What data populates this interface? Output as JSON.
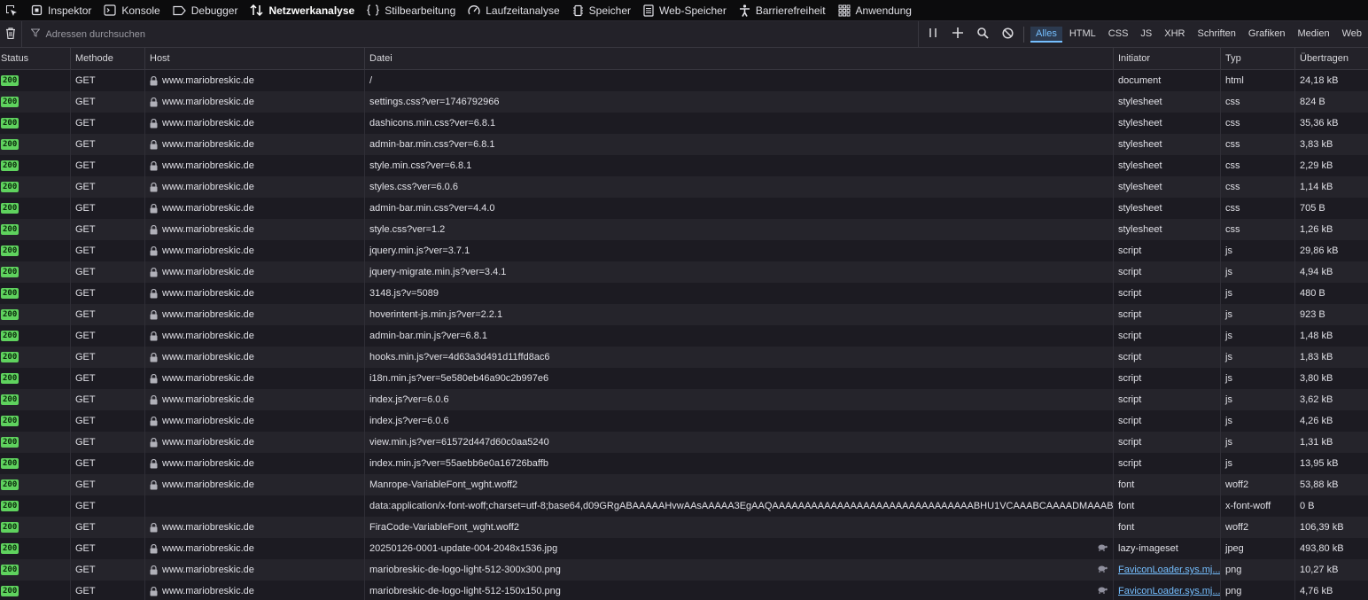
{
  "tabs": [
    {
      "label": "Inspektor",
      "icon": "inspector-icon"
    },
    {
      "label": "Konsole",
      "icon": "console-icon"
    },
    {
      "label": "Debugger",
      "icon": "debugger-icon"
    },
    {
      "label": "Netzwerkanalyse",
      "icon": "network-icon",
      "active": true
    },
    {
      "label": "Stilbearbeitung",
      "icon": "style-editor-icon"
    },
    {
      "label": "Laufzeitanalyse",
      "icon": "performance-icon"
    },
    {
      "label": "Speicher",
      "icon": "memory-icon"
    },
    {
      "label": "Web-Speicher",
      "icon": "storage-icon"
    },
    {
      "label": "Barrierefreiheit",
      "icon": "accessibility-icon"
    },
    {
      "label": "Anwendung",
      "icon": "application-icon"
    }
  ],
  "toolbar": {
    "filter_placeholder": "Adressen durchsuchen",
    "type_filters": [
      {
        "label": "Alles",
        "active": true
      },
      {
        "label": "HTML"
      },
      {
        "label": "CSS"
      },
      {
        "label": "JS"
      },
      {
        "label": "XHR"
      },
      {
        "label": "Schriften"
      },
      {
        "label": "Grafiken"
      },
      {
        "label": "Medien"
      },
      {
        "label": "Web"
      }
    ]
  },
  "columns": {
    "status": "Status",
    "method": "Methode",
    "host": "Host",
    "file": "Datei",
    "initiator": "Initiator",
    "type": "Typ",
    "transferred": "Übertragen"
  },
  "rows": [
    {
      "status": "200",
      "method": "GET",
      "host": "www.mariobreskic.de",
      "file": "/",
      "initiator": "document",
      "type": "html",
      "size": "24,18 kB"
    },
    {
      "status": "200",
      "method": "GET",
      "host": "www.mariobreskic.de",
      "file": "settings.css?ver=1746792966",
      "initiator": "stylesheet",
      "type": "css",
      "size": "824 B"
    },
    {
      "status": "200",
      "method": "GET",
      "host": "www.mariobreskic.de",
      "file": "dashicons.min.css?ver=6.8.1",
      "initiator": "stylesheet",
      "type": "css",
      "size": "35,36 kB"
    },
    {
      "status": "200",
      "method": "GET",
      "host": "www.mariobreskic.de",
      "file": "admin-bar.min.css?ver=6.8.1",
      "initiator": "stylesheet",
      "type": "css",
      "size": "3,83 kB"
    },
    {
      "status": "200",
      "method": "GET",
      "host": "www.mariobreskic.de",
      "file": "style.min.css?ver=6.8.1",
      "initiator": "stylesheet",
      "type": "css",
      "size": "2,29 kB"
    },
    {
      "status": "200",
      "method": "GET",
      "host": "www.mariobreskic.de",
      "file": "styles.css?ver=6.0.6",
      "initiator": "stylesheet",
      "type": "css",
      "size": "1,14 kB"
    },
    {
      "status": "200",
      "method": "GET",
      "host": "www.mariobreskic.de",
      "file": "admin-bar.min.css?ver=4.4.0",
      "initiator": "stylesheet",
      "type": "css",
      "size": "705 B"
    },
    {
      "status": "200",
      "method": "GET",
      "host": "www.mariobreskic.de",
      "file": "style.css?ver=1.2",
      "initiator": "stylesheet",
      "type": "css",
      "size": "1,26 kB"
    },
    {
      "status": "200",
      "method": "GET",
      "host": "www.mariobreskic.de",
      "file": "jquery.min.js?ver=3.7.1",
      "initiator": "script",
      "type": "js",
      "size": "29,86 kB"
    },
    {
      "status": "200",
      "method": "GET",
      "host": "www.mariobreskic.de",
      "file": "jquery-migrate.min.js?ver=3.4.1",
      "initiator": "script",
      "type": "js",
      "size": "4,94 kB"
    },
    {
      "status": "200",
      "method": "GET",
      "host": "www.mariobreskic.de",
      "file": "3148.js?v=5089",
      "initiator": "script",
      "type": "js",
      "size": "480 B"
    },
    {
      "status": "200",
      "method": "GET",
      "host": "www.mariobreskic.de",
      "file": "hoverintent-js.min.js?ver=2.2.1",
      "initiator": "script",
      "type": "js",
      "size": "923 B"
    },
    {
      "status": "200",
      "method": "GET",
      "host": "www.mariobreskic.de",
      "file": "admin-bar.min.js?ver=6.8.1",
      "initiator": "script",
      "type": "js",
      "size": "1,48 kB"
    },
    {
      "status": "200",
      "method": "GET",
      "host": "www.mariobreskic.de",
      "file": "hooks.min.js?ver=4d63a3d491d11ffd8ac6",
      "initiator": "script",
      "type": "js",
      "size": "1,83 kB"
    },
    {
      "status": "200",
      "method": "GET",
      "host": "www.mariobreskic.de",
      "file": "i18n.min.js?ver=5e580eb46a90c2b997e6",
      "initiator": "script",
      "type": "js",
      "size": "3,80 kB"
    },
    {
      "status": "200",
      "method": "GET",
      "host": "www.mariobreskic.de",
      "file": "index.js?ver=6.0.6",
      "initiator": "script",
      "type": "js",
      "size": "3,62 kB"
    },
    {
      "status": "200",
      "method": "GET",
      "host": "www.mariobreskic.de",
      "file": "index.js?ver=6.0.6",
      "initiator": "script",
      "type": "js",
      "size": "4,26 kB"
    },
    {
      "status": "200",
      "method": "GET",
      "host": "www.mariobreskic.de",
      "file": "view.min.js?ver=61572d447d60c0aa5240",
      "initiator": "script",
      "type": "js",
      "size": "1,31 kB"
    },
    {
      "status": "200",
      "method": "GET",
      "host": "www.mariobreskic.de",
      "file": "index.min.js?ver=55aebb6e0a16726baffb",
      "initiator": "script",
      "type": "js",
      "size": "13,95 kB"
    },
    {
      "status": "200",
      "method": "GET",
      "host": "www.mariobreskic.de",
      "file": "Manrope-VariableFont_wght.woff2",
      "initiator": "font",
      "type": "woff2",
      "size": "53,88 kB"
    },
    {
      "status": "200",
      "method": "GET",
      "host": "",
      "file": "data:application/x-font-woff;charset=utf-8;base64,d09GRgABAAAAAHvwAAsAAAAA3EgAAQAAAAAAAAAAAAAAAAAAAAAAAAAAAAAAABHU1VCAAABCAAAADMAAABCsP6z7U9",
      "initiator": "font",
      "type": "x-font-woff",
      "size": "0 B",
      "no_lock": true
    },
    {
      "status": "200",
      "method": "GET",
      "host": "www.mariobreskic.de",
      "file": "FiraCode-VariableFont_wght.woff2",
      "initiator": "font",
      "type": "woff2",
      "size": "106,39 kB"
    },
    {
      "status": "200",
      "method": "GET",
      "host": "www.mariobreskic.de",
      "file": "20250126-0001-update-004-2048x1536.jpg",
      "initiator": "lazy-imageset",
      "type": "jpeg",
      "size": "493,80 kB",
      "turtle": true
    },
    {
      "status": "200",
      "method": "GET",
      "host": "www.mariobreskic.de",
      "file": "mariobreskic-de-logo-light-512-300x300.png",
      "initiator": "FaviconLoader.sys.mj...",
      "type": "png",
      "size": "10,27 kB",
      "turtle": true,
      "initiator_link": true
    },
    {
      "status": "200",
      "method": "GET",
      "host": "www.mariobreskic.de",
      "file": "mariobreskic-de-logo-light-512-150x150.png",
      "initiator": "FaviconLoader.sys.mj...",
      "type": "png",
      "size": "4,76 kB",
      "turtle": true,
      "initiator_link": true
    }
  ]
}
